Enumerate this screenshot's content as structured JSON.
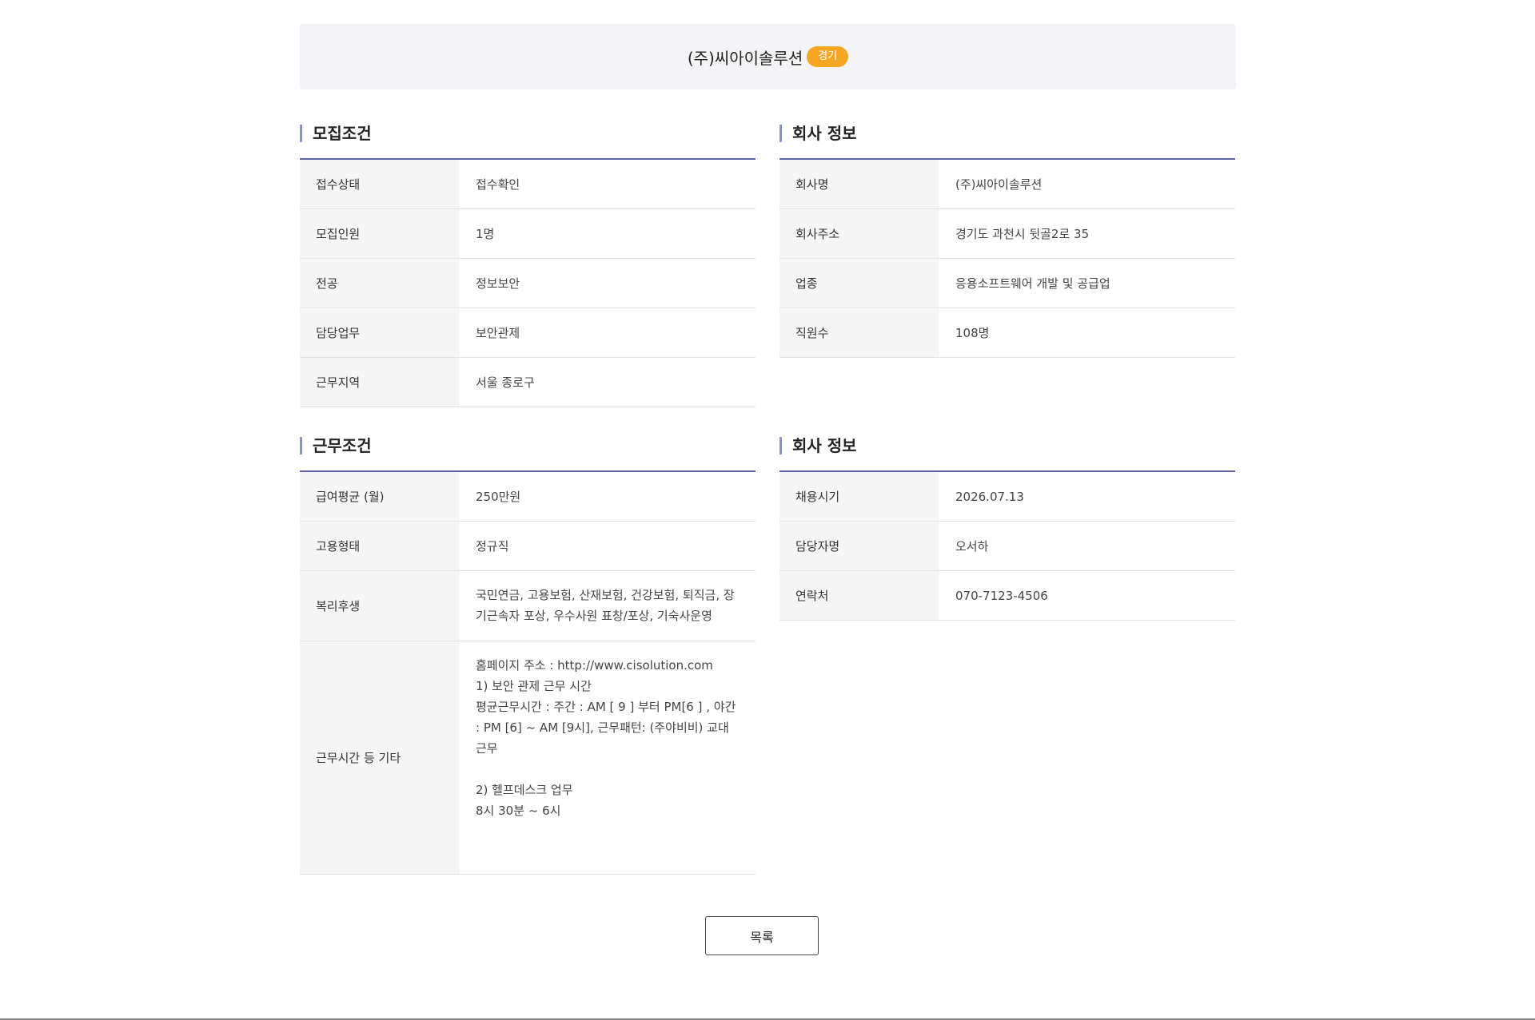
{
  "header": {
    "company_name": "(주)씨아이솔루션",
    "region_badge": "경기",
    "badge_color": "#f5a623"
  },
  "recruit": {
    "title": "모집조건",
    "rows": [
      {
        "label": "접수상태",
        "value": "접수확인"
      },
      {
        "label": "모집인원",
        "value": "1명"
      },
      {
        "label": "전공",
        "value": "정보보안"
      },
      {
        "label": "담당업무",
        "value": "보안관제"
      },
      {
        "label": "근무지역",
        "value": "서울 종로구"
      }
    ]
  },
  "company_info": {
    "title": "회사 정보",
    "rows": [
      {
        "label": "회사명",
        "value": "(주)씨아이솔루션"
      },
      {
        "label": "회사주소",
        "value": "경기도 과천시 뒷골2로 35"
      },
      {
        "label": "업종",
        "value": "응용소프트웨어 개발 및 공급업"
      },
      {
        "label": "직원수",
        "value": "108명"
      }
    ]
  },
  "work": {
    "title": "근무조건",
    "rows": [
      {
        "label": "급여평균 (월)",
        "value": "250만원"
      },
      {
        "label": "고용형태",
        "value": "정규직"
      },
      {
        "label": "복리후생",
        "value": "국민연금, 고용보험, 산재보험, 건강보험, 퇴직금, 장기근속자 포상, 우수사원 표창/포상, 기숙사운영"
      },
      {
        "label": "근무시간 등 기타",
        "value": "홈페이지 주소 : http://www.cisolution.com\n1) 보안 관제 근무 시간\n평균근무시간 : 주간 : AM [ 9 ] 부터 PM[6 ] , 야간 : PM [6] ~ AM [9시], 근무패턴: (주야비비) 교대 근무\n\n2) 헬프데스크 업무\n8시 30분 ~ 6시"
      }
    ]
  },
  "hiring_info": {
    "title": "회사 정보",
    "rows": [
      {
        "label": "채용시기",
        "value": "2026.07.13"
      },
      {
        "label": "담당자명",
        "value": "오서하"
      },
      {
        "label": "연락처",
        "value": "070-7123-4506"
      }
    ]
  },
  "actions": {
    "list_label": "목록"
  },
  "colors": {
    "accent": "#5b62a8",
    "section_bar": "#8e95cc"
  }
}
